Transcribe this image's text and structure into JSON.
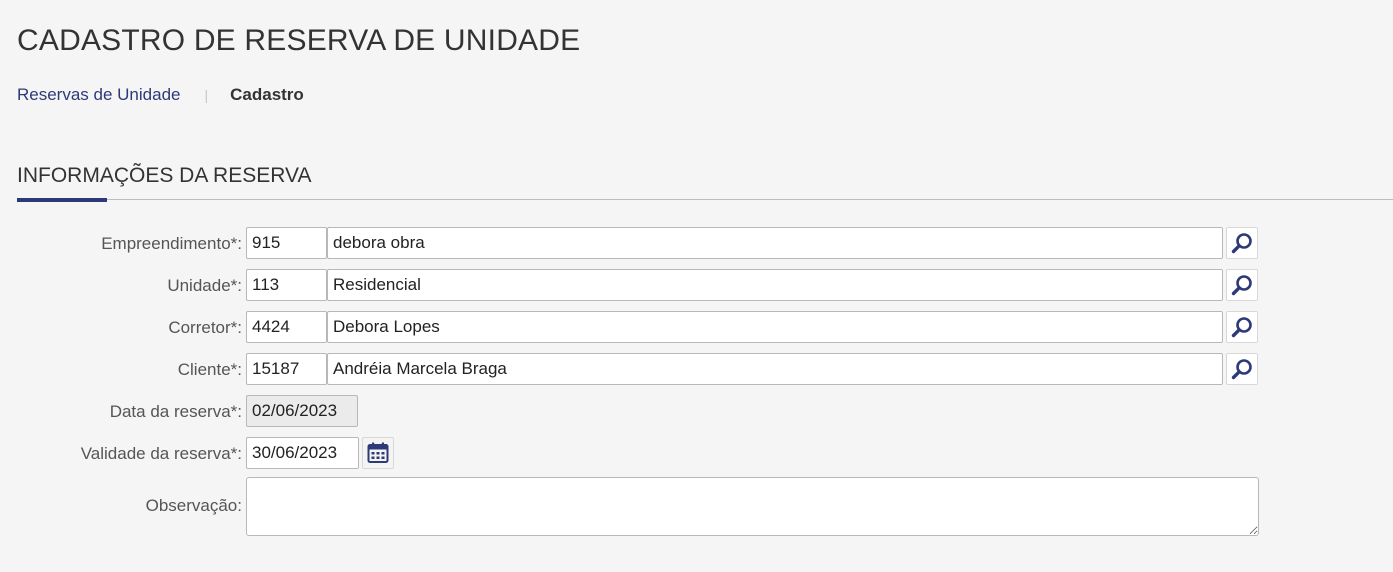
{
  "page": {
    "title": "CADASTRO DE RESERVA DE UNIDADE"
  },
  "breadcrumb": {
    "link": "Reservas de Unidade",
    "separator": "|",
    "current": "Cadastro"
  },
  "section": {
    "title": "INFORMAÇÕES DA RESERVA",
    "accent_color": "#2e3a78"
  },
  "form": {
    "empreendimento": {
      "label": "Empreendimento*:",
      "code": "915",
      "description": "debora obra",
      "icon": "search-icon"
    },
    "unidade": {
      "label": "Unidade*:",
      "code": "113",
      "description": "Residencial",
      "icon": "search-icon"
    },
    "corretor": {
      "label": "Corretor*:",
      "code": "4424",
      "description": "Debora Lopes",
      "icon": "search-icon"
    },
    "cliente": {
      "label": "Cliente*:",
      "code": "15187",
      "description": "Andréia Marcela Braga",
      "icon": "search-icon"
    },
    "data_reserva": {
      "label": "Data da reserva*:",
      "value": "02/06/2023"
    },
    "validade_reserva": {
      "label": "Validade da reserva*:",
      "value": "30/06/2023",
      "icon": "calendar-icon"
    },
    "observacao": {
      "label": "Observação:",
      "value": ""
    }
  }
}
